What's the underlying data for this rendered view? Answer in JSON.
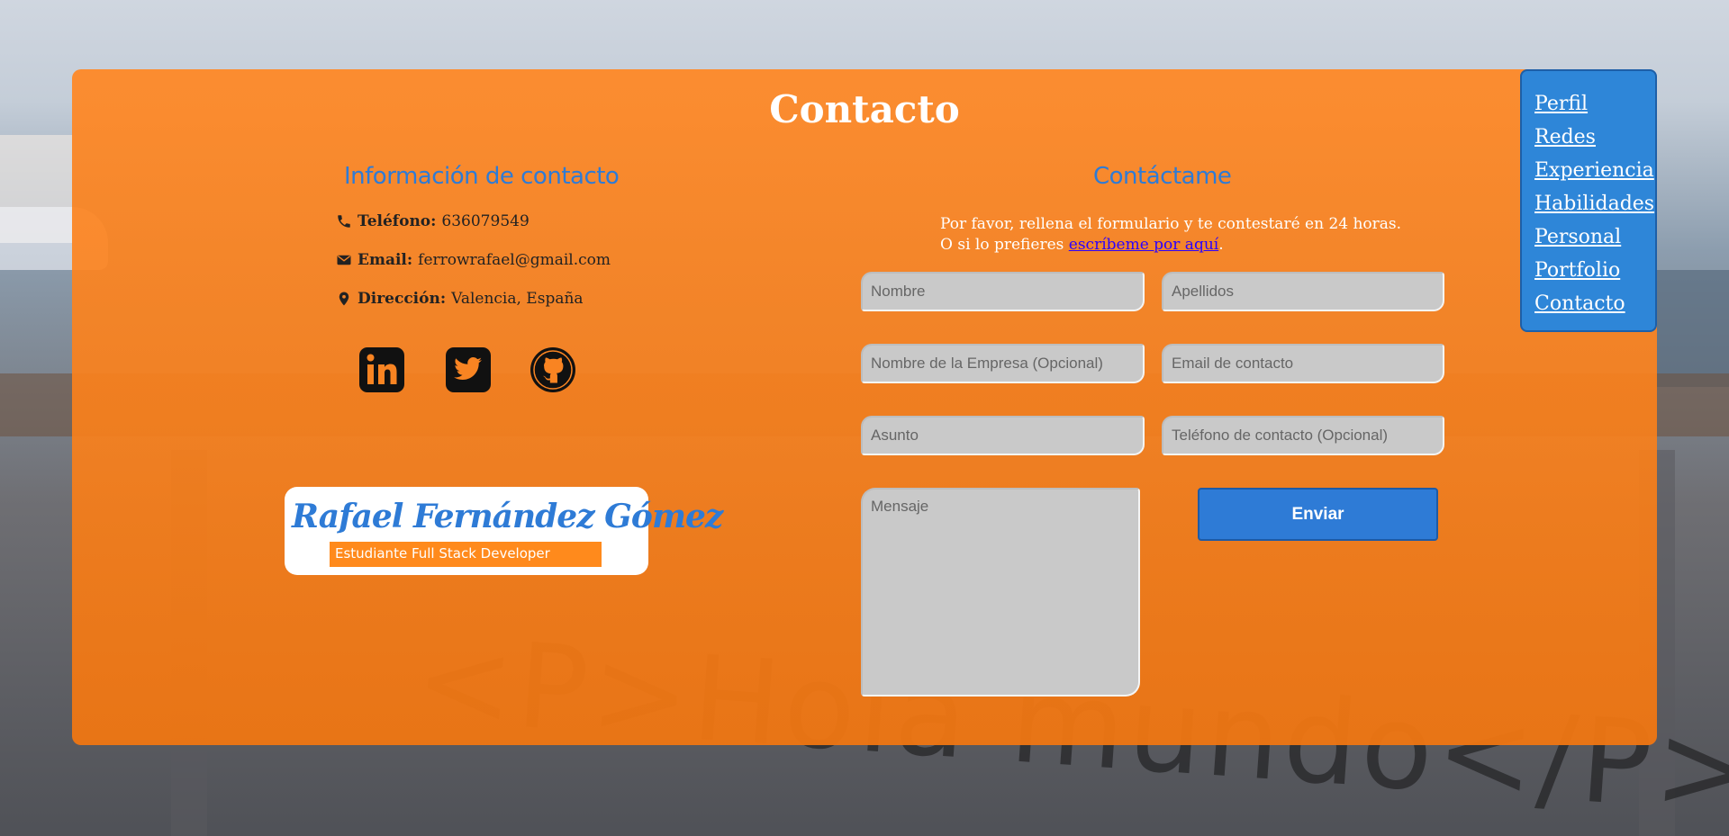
{
  "page": {
    "title": "Contacto"
  },
  "contact_info": {
    "heading": "Información de contacto",
    "phone_label": "Teléfono:",
    "phone_value": "636079549",
    "email_label": "Email:",
    "email_value": "ferrowrafael@gmail.com",
    "address_label": "Dirección:",
    "address_value": "Valencia, España",
    "icons": [
      "phone-icon",
      "envelope-icon",
      "map-marker-icon"
    ],
    "social": [
      "linkedin-icon",
      "twitter-icon",
      "github-icon"
    ]
  },
  "logo": {
    "name": "Rafael Fernández Gómez",
    "subtitle": "Estudiante Full Stack Developer"
  },
  "form": {
    "heading": "Contáctame",
    "intro_line1": "Por favor, rellena el formulario y te contestaré en 24 horas.",
    "intro_line2_prefix": "O si lo prefieres ",
    "intro_link": "escríbeme por aquí",
    "intro_line2_suffix": ".",
    "placeholders": {
      "nombre": "Nombre",
      "apellidos": "Apellidos",
      "empresa": "Nombre de la Empresa (Opcional)",
      "email": "Email de contacto",
      "asunto": "Asunto",
      "telefono": "Teléfono de contacto (Opcional)",
      "mensaje": "Mensaje"
    },
    "submit_label": "Enviar"
  },
  "nav": {
    "items": [
      "Perfil",
      "Redes",
      "Experiencia",
      "Habilidades",
      "Personal",
      "Portfolio",
      "Contacto"
    ]
  },
  "background": {
    "graffiti": "<P>Hola mundo</P>"
  },
  "colors": {
    "card_orange": "#ff8723",
    "accent_blue": "#2e7bd6",
    "field_gray": "#c9c9c9",
    "link_blue": "#2b00ff"
  }
}
